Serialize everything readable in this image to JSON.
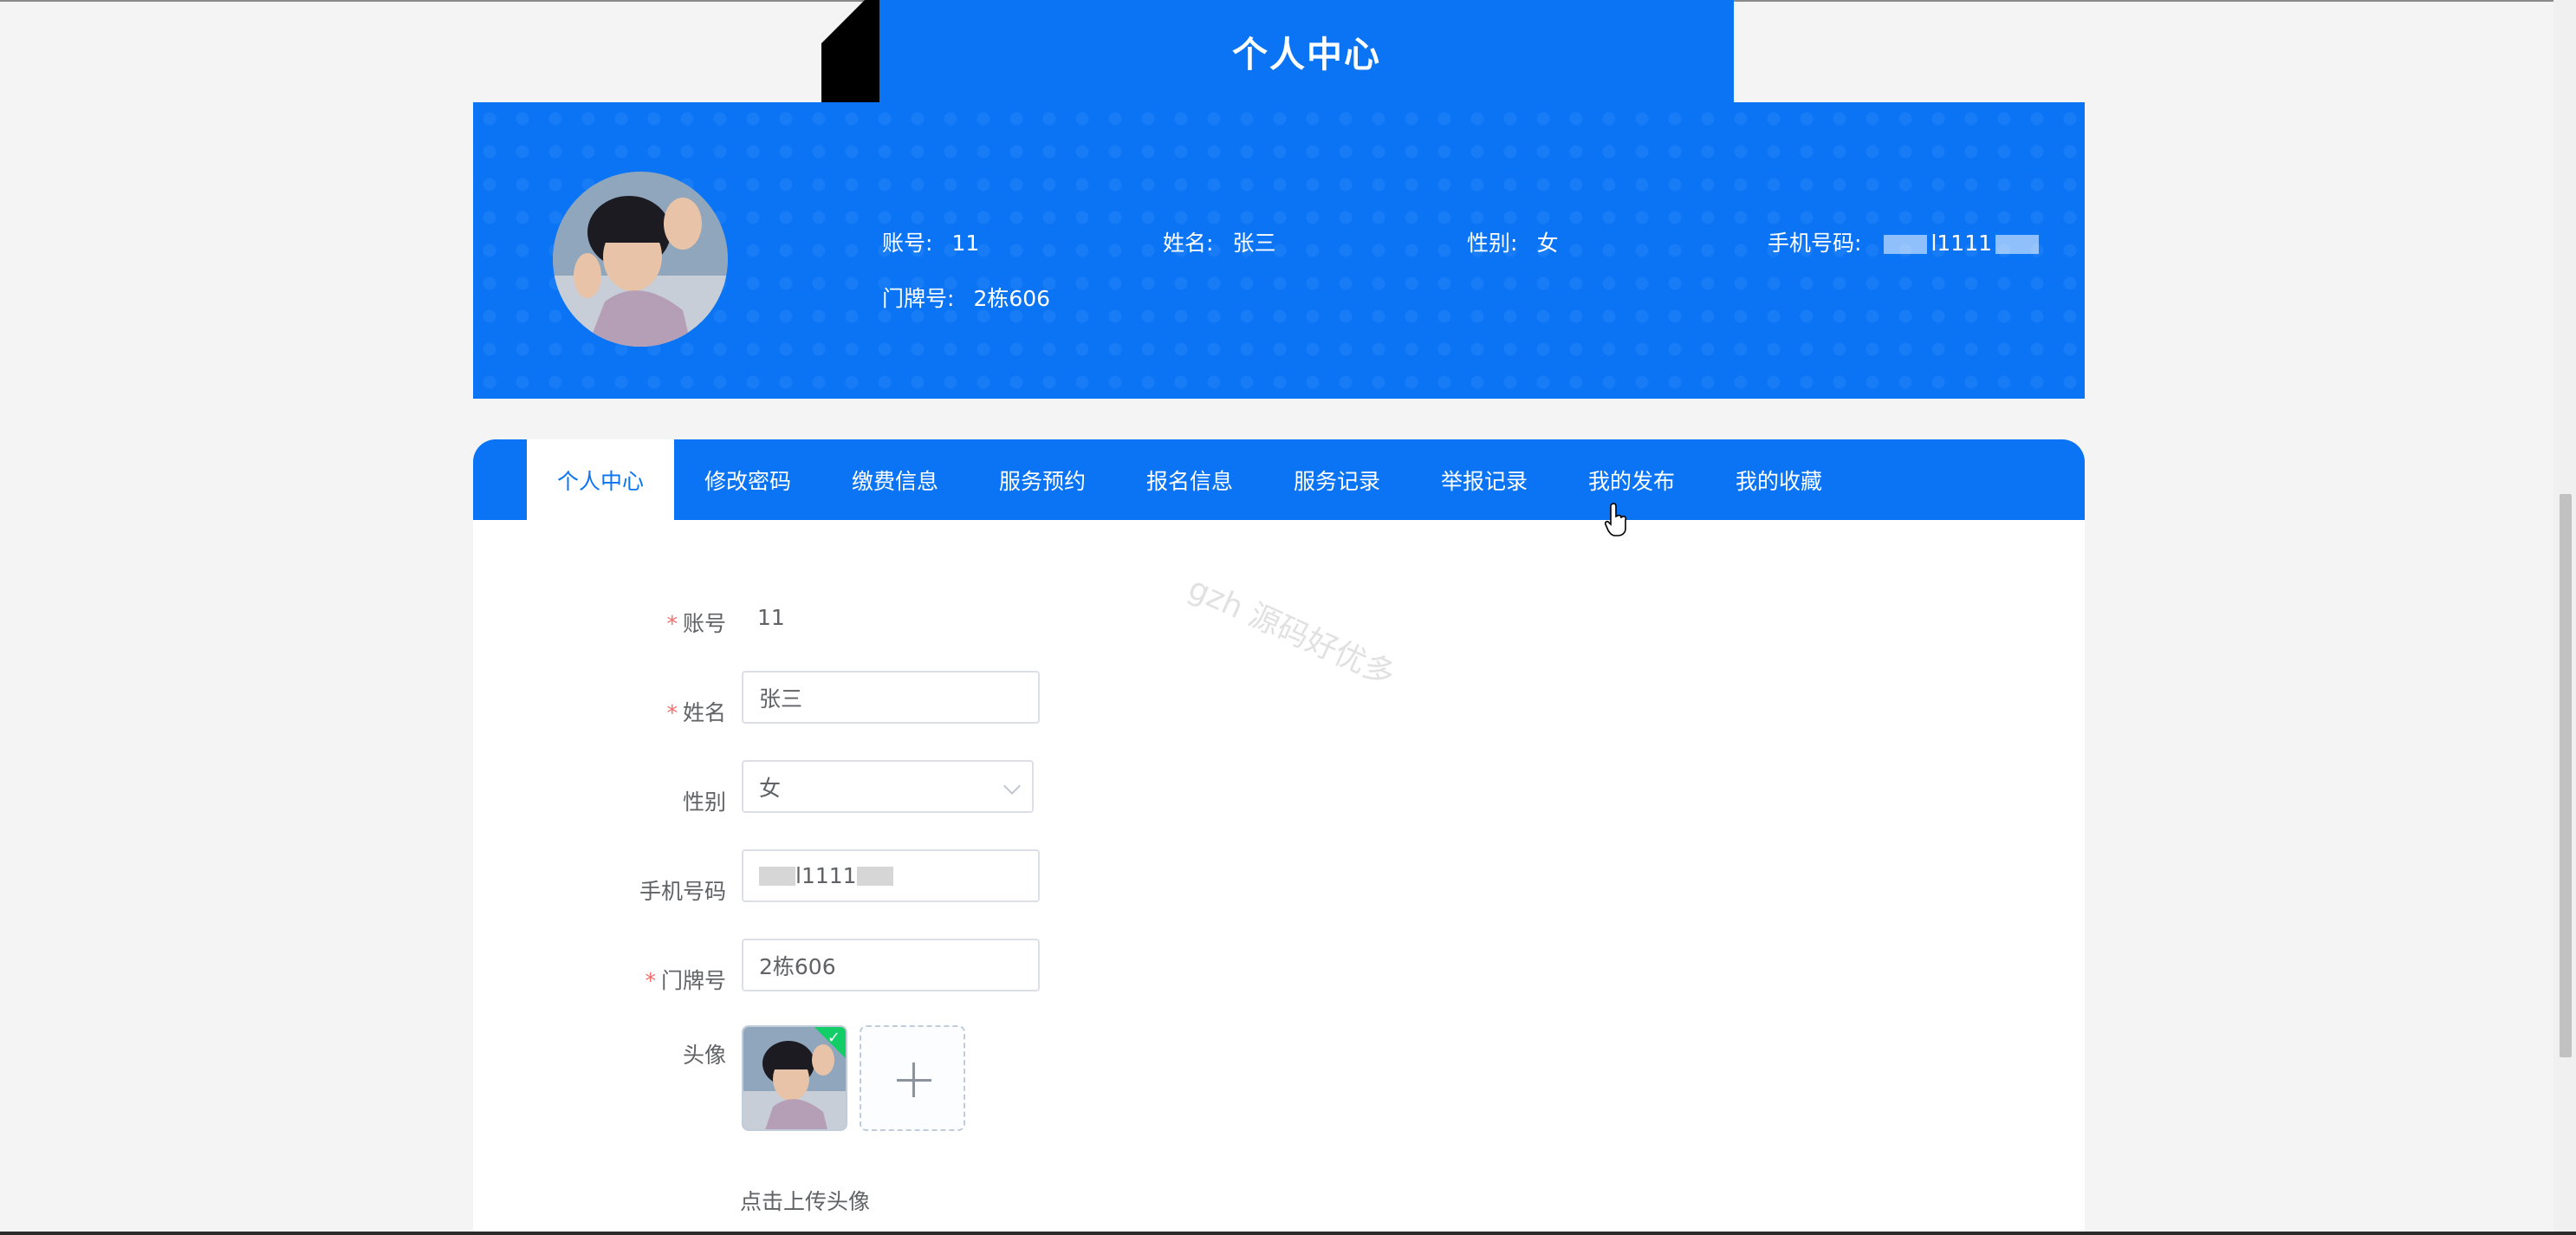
{
  "page": {
    "title": "个人中心"
  },
  "profile": {
    "account_label": "账号:",
    "account_value": "11",
    "name_label": "姓名:",
    "name_value": "张三",
    "gender_label": "性别:",
    "gender_value": "女",
    "phone_label": "手机号码:",
    "phone_value_visible": "l1111",
    "door_label": "门牌号:",
    "door_value": "2栋606"
  },
  "tabs": [
    {
      "label": "个人中心",
      "active": true
    },
    {
      "label": "修改密码"
    },
    {
      "label": "缴费信息"
    },
    {
      "label": "服务预约"
    },
    {
      "label": "报名信息"
    },
    {
      "label": "服务记录"
    },
    {
      "label": "举报记录"
    },
    {
      "label": "我的发布"
    },
    {
      "label": "我的收藏"
    }
  ],
  "form": {
    "account": {
      "label": "账号",
      "value": "11"
    },
    "name": {
      "label": "姓名",
      "value": "张三"
    },
    "gender": {
      "label": "性别",
      "value": "女"
    },
    "phone": {
      "label": "手机号码",
      "value_visible": "l1111"
    },
    "door": {
      "label": "门牌号",
      "value": "2栋606"
    },
    "avatar": {
      "label": "头像",
      "upload_tip": "点击上传头像"
    }
  },
  "watermark": "gzh 源码好优多",
  "colors": {
    "primary": "#0a74f5",
    "required": "#f56c6c",
    "success": "#13ce66"
  }
}
